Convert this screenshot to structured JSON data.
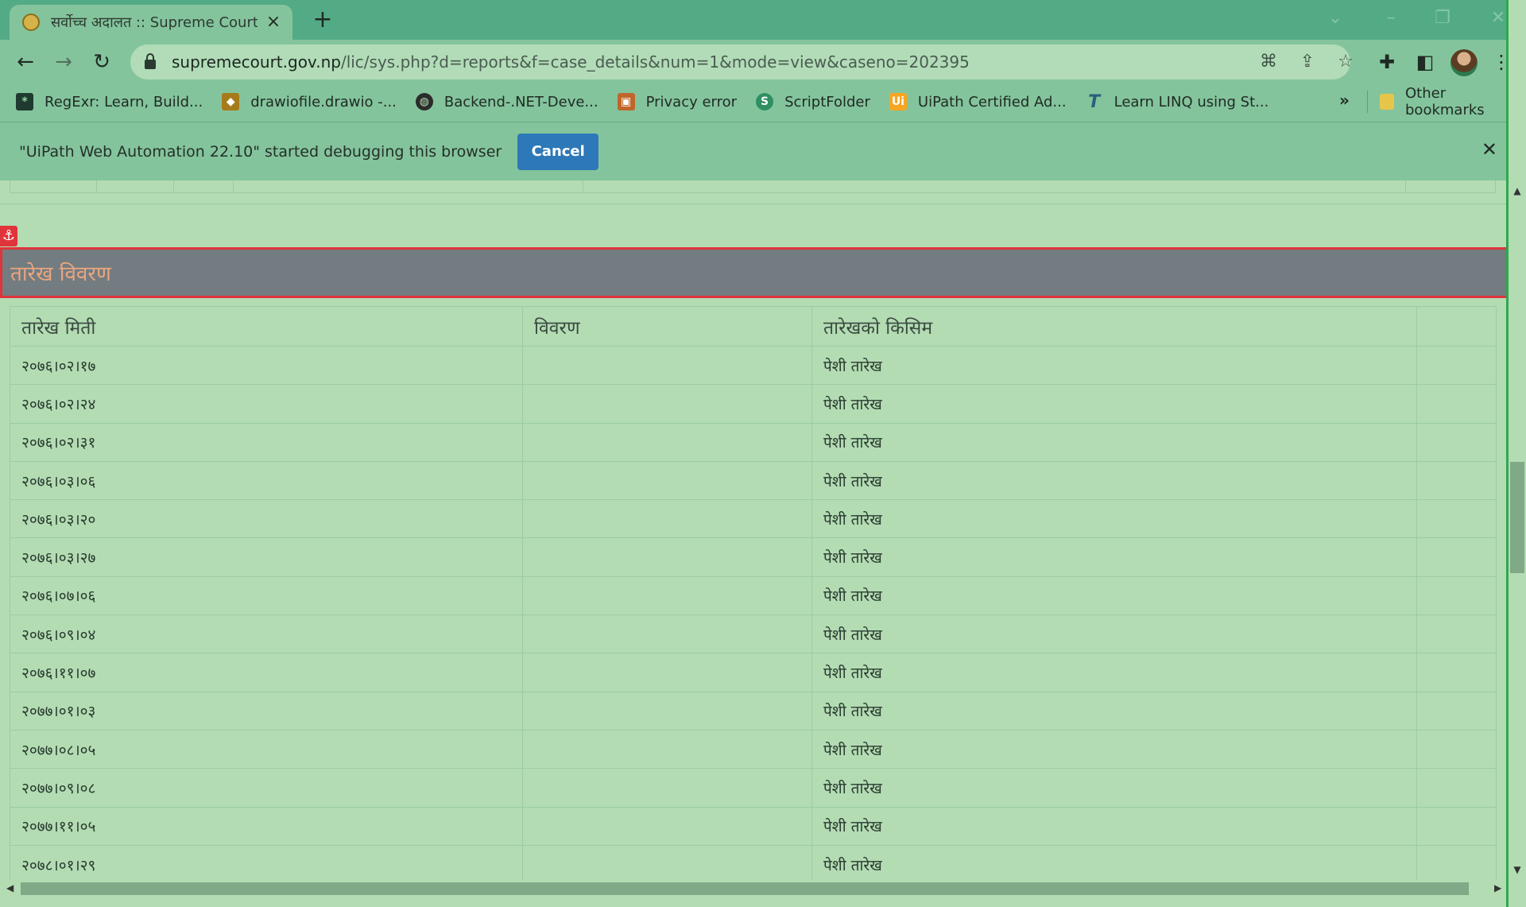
{
  "browser": {
    "tab_title": "सर्वोच्च अदालत :: Supreme Court of Nepal",
    "url_host": "supremecourt.gov.np",
    "url_path": "/lic/sys.php?d=reports&f=case_details&num=1&mode=view&caseno=202395",
    "bookmarks": [
      {
        "label": "RegExr: Learn, Build...",
        "icon": "regexr-icon"
      },
      {
        "label": "drawiofile.drawio -...",
        "icon": "drawio-icon"
      },
      {
        "label": "Backend-.NET-Deve...",
        "icon": "globe-icon"
      },
      {
        "label": "Privacy error",
        "icon": "lock-icon"
      },
      {
        "label": "ScriptFolder",
        "icon": "scriptfolder-icon"
      },
      {
        "label": "UiPath Certified Ad...",
        "icon": "uipath-icon"
      },
      {
        "label": "Learn LINQ using St...",
        "icon": "linq-icon"
      }
    ],
    "bookmarks_overflow": "»",
    "other_bookmarks": "Other bookmarks"
  },
  "infobar": {
    "message": "\"UiPath Web Automation 22.10\" started debugging this browser",
    "cancel_label": "Cancel"
  },
  "section": {
    "title": "तारेख विवरण"
  },
  "table": {
    "columns": [
      "तारेख मिती",
      "विवरण",
      "तारेखको किसिम",
      ""
    ],
    "rows": [
      [
        "२०७६।०२।१७",
        "",
        "पेशी तारेख",
        ""
      ],
      [
        "२०७६।०२।२४",
        "",
        "पेशी तारेख",
        ""
      ],
      [
        "२०७६।०२।३१",
        "",
        "पेशी तारेख",
        ""
      ],
      [
        "२०७६।०३।०६",
        "",
        "पेशी तारेख",
        ""
      ],
      [
        "२०७६।०३।२०",
        "",
        "पेशी तारेख",
        ""
      ],
      [
        "२०७६।०३।२७",
        "",
        "पेशी तारेख",
        ""
      ],
      [
        "२०७६।०७।०६",
        "",
        "पेशी तारेख",
        ""
      ],
      [
        "२०७६।०९।०४",
        "",
        "पेशी तारेख",
        ""
      ],
      [
        "२०७६।११।०७",
        "",
        "पेशी तारेख",
        ""
      ],
      [
        "२०७७।०१।०३",
        "",
        "पेशी तारेख",
        ""
      ],
      [
        "२०७७।०८।०५",
        "",
        "पेशी तारेख",
        ""
      ],
      [
        "२०७७।०९।०८",
        "",
        "पेशी तारेख",
        ""
      ],
      [
        "२०७७।११।०५",
        "",
        "पेशी तारेख",
        ""
      ],
      [
        "२०७८।०१।२९",
        "",
        "पेशी तारेख",
        ""
      ]
    ]
  },
  "colors": {
    "section_header_bg": "#737c80",
    "section_title": "#eaa57f",
    "highlight_border": "#e0343b",
    "infobar_button": "#2d78b8"
  }
}
